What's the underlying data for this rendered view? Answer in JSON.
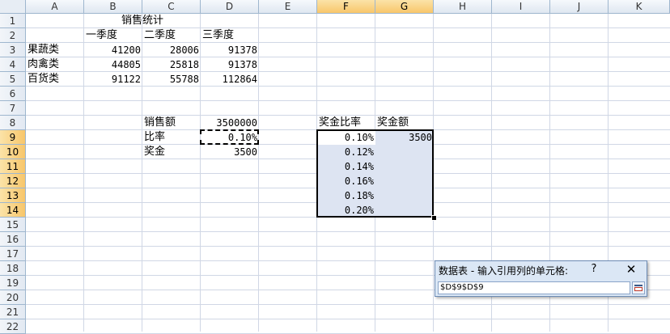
{
  "columns": [
    "A",
    "B",
    "C",
    "D",
    "E",
    "F",
    "G",
    "H",
    "I",
    "J",
    "K"
  ],
  "rows": [
    "1",
    "2",
    "3",
    "4",
    "5",
    "6",
    "7",
    "8",
    "9",
    "10",
    "11",
    "12",
    "13",
    "14",
    "15",
    "16",
    "17",
    "18",
    "19",
    "20",
    "21",
    "22"
  ],
  "cells": {
    "title": "销售统计",
    "q1": "一季度",
    "q2": "二季度",
    "q3": "三季度",
    "data_rows": [
      {
        "name": "果蔬类",
        "q1": "41200",
        "q2": "28006",
        "q3": "91378"
      },
      {
        "name": "肉禽类",
        "q1": "44805",
        "q2": "25818",
        "q3": "91378"
      },
      {
        "name": "百货类",
        "q1": "91122",
        "q2": "55788",
        "q3": "112864"
      }
    ],
    "sales_label": "销售额",
    "sales_value": "3500000",
    "rate_label": "比率",
    "rate_value": "0.10%",
    "bonus_label": "奖金",
    "bonus_value": "3500",
    "table_header_rate": "奖金比率",
    "table_header_bonus": "奖金额",
    "rates": [
      "0.10%",
      "0.12%",
      "0.14%",
      "0.16%",
      "0.18%",
      "0.20%"
    ],
    "first_bonus": "3500"
  },
  "dialog": {
    "title": "数据表 - 输入引用列的单元格:",
    "help": "?",
    "close": "✕",
    "input_value": "$D$9$D$9"
  }
}
